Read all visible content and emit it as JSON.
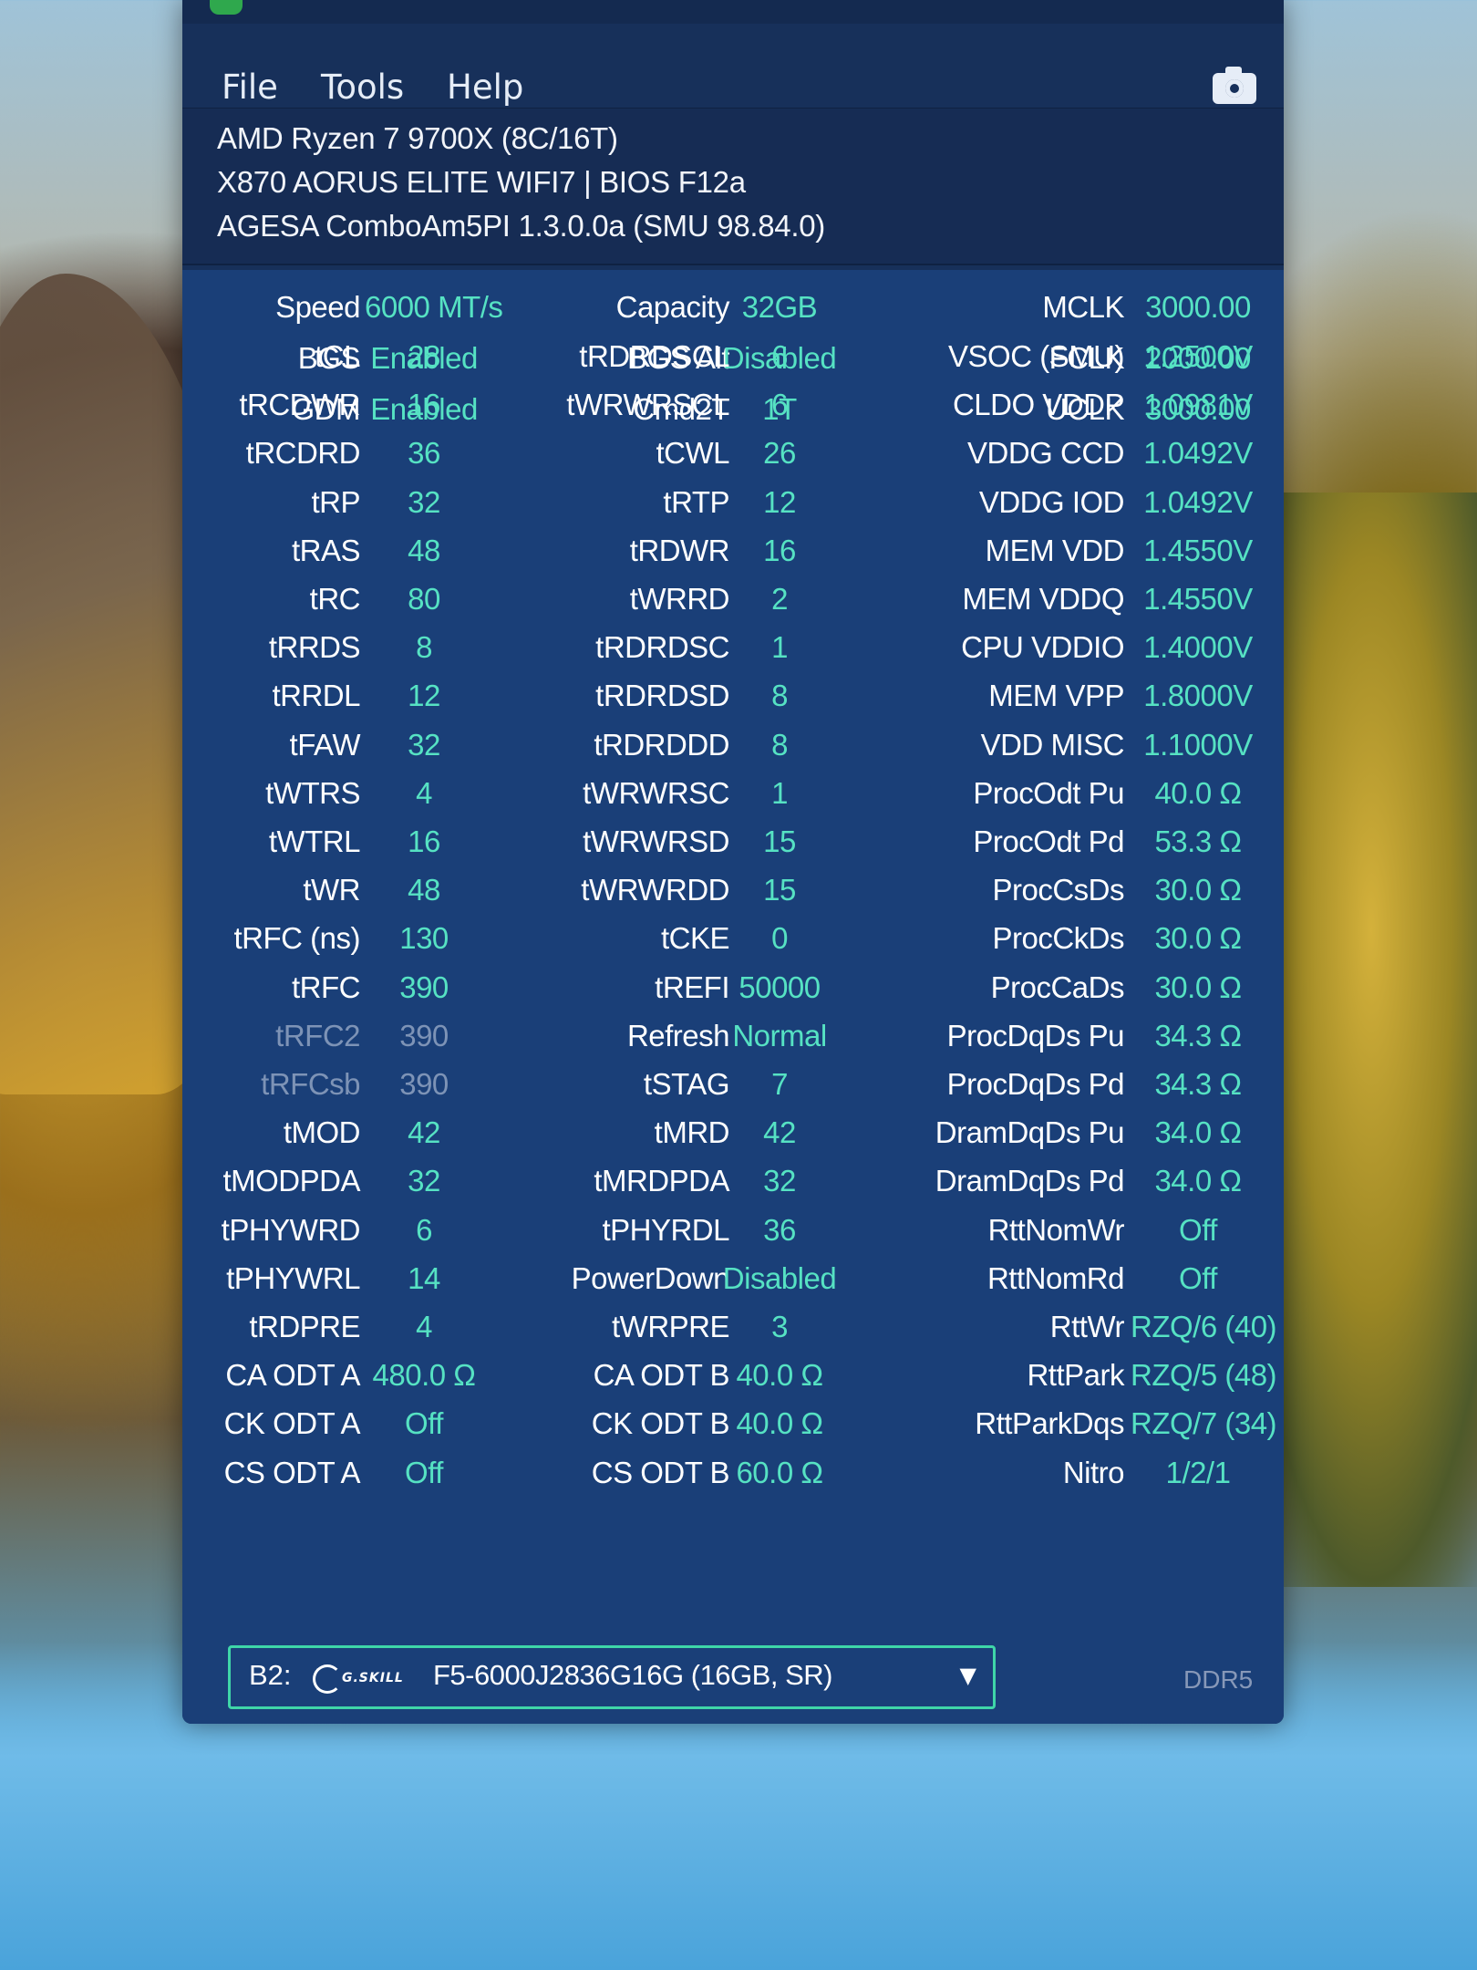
{
  "menu": {
    "file": "File",
    "tools": "Tools",
    "help": "Help",
    "screenshot_icon": "camera-icon"
  },
  "info": {
    "cpu": "AMD Ryzen 7 9700X (8C/16T)",
    "board": "X870 AORUS ELITE WIFI7 | BIOS F12a",
    "agesa": "AGESA ComboAm5PI 1.3.0.0a (SMU 98.84.0)"
  },
  "summary": [
    [
      "Speed",
      "6000 MT/s",
      "Capacity",
      "32GB",
      "MCLK",
      "3000.00"
    ],
    [
      "BGS",
      "Enabled",
      "BGS Alt",
      "Disabled",
      "FCLK",
      "2000.00"
    ],
    [
      "GDM",
      "Enabled",
      "Cmd2T",
      "1T",
      "UCLK",
      "3000.00"
    ]
  ],
  "timings": [
    [
      "tCL",
      "28",
      "tRDRDSCL",
      "6",
      "VSOC (SMU)",
      "1.2500V"
    ],
    [
      "tRCDWR",
      "16",
      "tWRWRSCL",
      "6",
      "CLDO VDDP",
      "1.0981V"
    ],
    [
      "tRCDRD",
      "36",
      "tCWL",
      "26",
      "VDDG CCD",
      "1.0492V"
    ],
    [
      "tRP",
      "32",
      "tRTP",
      "12",
      "VDDG IOD",
      "1.0492V"
    ],
    [
      "tRAS",
      "48",
      "tRDWR",
      "16",
      "MEM VDD",
      "1.4550V"
    ],
    [
      "tRC",
      "80",
      "tWRRD",
      "2",
      "MEM VDDQ",
      "1.4550V"
    ],
    [
      "tRRDS",
      "8",
      "tRDRDSC",
      "1",
      "CPU VDDIO",
      "1.4000V"
    ],
    [
      "tRRDL",
      "12",
      "tRDRDSD",
      "8",
      "MEM VPP",
      "1.8000V"
    ],
    [
      "tFAW",
      "32",
      "tRDRDDD",
      "8",
      "VDD MISC",
      "1.1000V"
    ],
    [
      "tWTRS",
      "4",
      "tWRWRSC",
      "1",
      "ProcOdt Pu",
      "40.0 Ω"
    ],
    [
      "tWTRL",
      "16",
      "tWRWRSD",
      "15",
      "ProcOdt Pd",
      "53.3 Ω"
    ],
    [
      "tWR",
      "48",
      "tWRWRDD",
      "15",
      "ProcCsDs",
      "30.0 Ω"
    ],
    [
      "tRFC (ns)",
      "130",
      "tCKE",
      "0",
      "ProcCkDs",
      "30.0 Ω"
    ],
    [
      "tRFC",
      "390",
      "tREFI",
      "50000",
      "ProcCaDs",
      "30.0 Ω"
    ],
    [
      "tRFC2",
      "390",
      "Refresh",
      "Normal",
      "ProcDqDs Pu",
      "34.3 Ω"
    ],
    [
      "tRFCsb",
      "390",
      "tSTAG",
      "7",
      "ProcDqDs Pd",
      "34.3 Ω"
    ],
    [
      "tMOD",
      "42",
      "tMRD",
      "42",
      "DramDqDs Pu",
      "34.0 Ω"
    ],
    [
      "tMODPDA",
      "32",
      "tMRDPDA",
      "32",
      "DramDqDs Pd",
      "34.0 Ω"
    ],
    [
      "tPHYWRD",
      "6",
      "tPHYRDL",
      "36",
      "RttNomWr",
      "Off"
    ],
    [
      "tPHYWRL",
      "14",
      "PowerDown",
      "Disabled",
      "RttNomRd",
      "Off"
    ],
    [
      "tRDPRE",
      "4",
      "tWRPRE",
      "3",
      "RttWr",
      "RZQ/6 (40)"
    ],
    [
      "CA ODT A",
      "480.0 Ω",
      "CA ODT B",
      "40.0 Ω",
      "RttPark",
      "RZQ/5 (48)"
    ],
    [
      "CK ODT A",
      "Off",
      "CK ODT B",
      "40.0 Ω",
      "RttParkDqs",
      "RZQ/7 (34)"
    ],
    [
      "CS ODT A",
      "Off",
      "CS ODT B",
      "60.0 Ω",
      "Nitro",
      "1/2/1"
    ]
  ],
  "module": {
    "slot": "B2:",
    "brand": "G.SKILL",
    "description": "F5-6000J2836G16G (16GB, SR)",
    "type": "DDR5"
  }
}
